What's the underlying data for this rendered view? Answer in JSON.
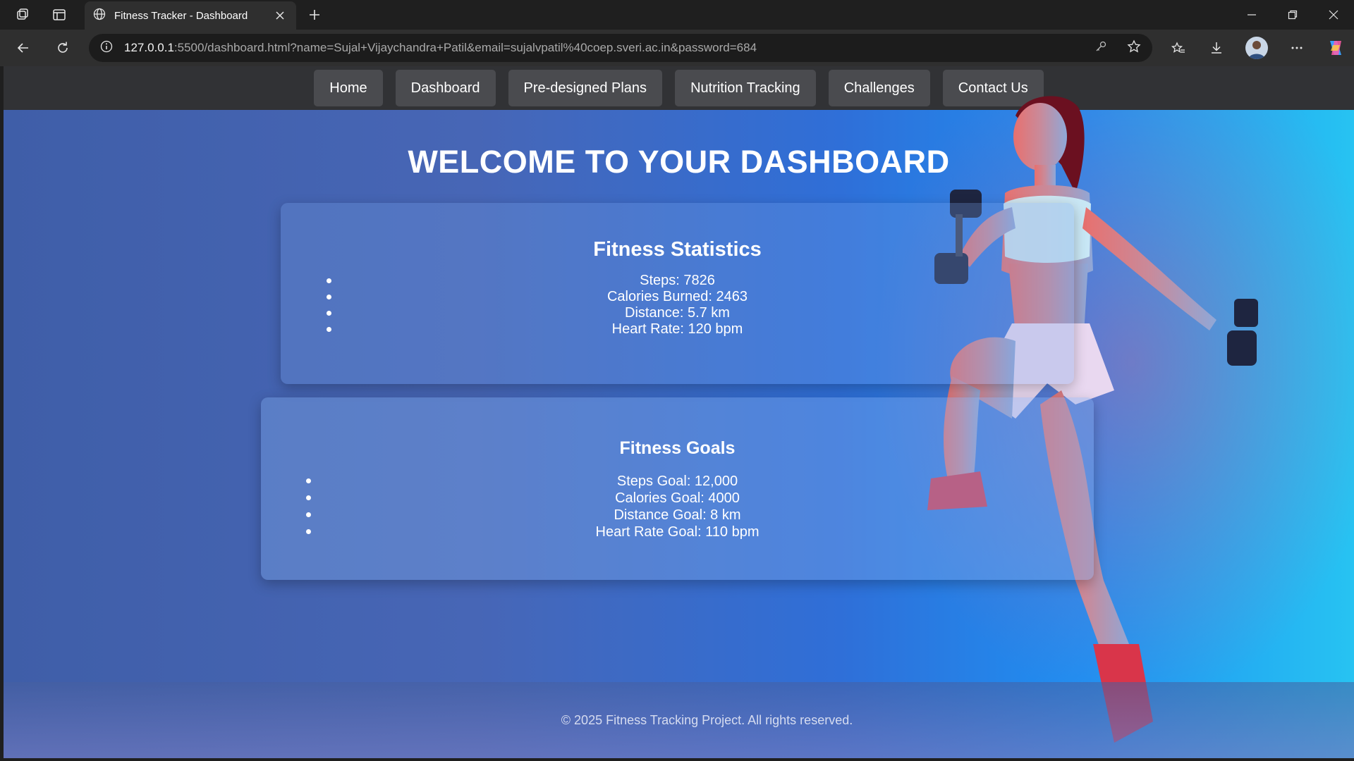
{
  "browser": {
    "tab_title": "Fitness Tracker - Dashboard",
    "url_host": "127.0.0.1",
    "url_rest": ":5500/dashboard.html?name=Sujal+Vijaychandra+Patil&email=sujalvpatil%40coep.sveri.ac.in&password=684"
  },
  "nav": {
    "items": [
      {
        "label": "Home"
      },
      {
        "label": "Dashboard"
      },
      {
        "label": "Pre-designed Plans"
      },
      {
        "label": "Nutrition Tracking"
      },
      {
        "label": "Challenges"
      },
      {
        "label": "Contact Us"
      }
    ]
  },
  "hero": {
    "title": "WELCOME TO YOUR DASHBOARD"
  },
  "stats": {
    "title": "Fitness Statistics",
    "items": [
      {
        "text": "Steps: 7826"
      },
      {
        "text": "Calories Burned: 2463"
      },
      {
        "text": "Distance: 5.7 km"
      },
      {
        "text": "Heart Rate: 120 bpm"
      }
    ]
  },
  "goals": {
    "title": "Fitness Goals",
    "items": [
      {
        "text": "Steps Goal: 12,000"
      },
      {
        "text": "Calories Goal: 4000"
      },
      {
        "text": "Distance Goal: 8 km"
      },
      {
        "text": "Heart Rate Goal: 110 bpm"
      }
    ]
  },
  "footer": {
    "text": "© 2025 Fitness Tracking Project. All rights reserved."
  },
  "colors": {
    "nav_bg": "#313235",
    "nav_button": "#4a4b4f",
    "page_gradient_start": "#3f5ea8",
    "page_gradient_end": "#27c3f2"
  }
}
